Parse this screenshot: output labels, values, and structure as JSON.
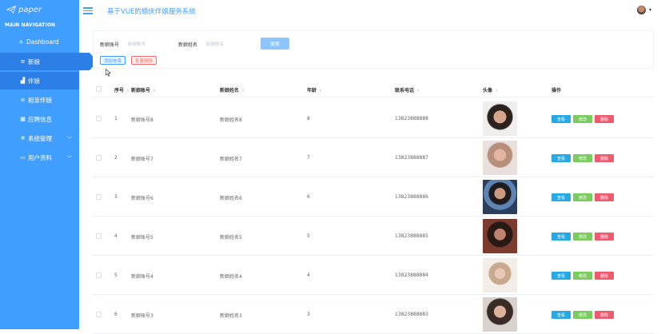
{
  "brand": {
    "logo_text": "paper"
  },
  "sidebar": {
    "section_title": "MAIN NAVIGATION",
    "items": [
      {
        "label": "Dashboard",
        "icon": "home-icon"
      },
      {
        "label": "新娘",
        "icon": "list-icon"
      },
      {
        "label": "伴娘",
        "icon": "chart-icon"
      },
      {
        "label": "相亲伴娘",
        "icon": "list-icon"
      },
      {
        "label": "应聘信息",
        "icon": "grid-icon"
      },
      {
        "label": "系统管理",
        "icon": "gear-icon"
      },
      {
        "label": "用户资料",
        "icon": "card-icon"
      }
    ]
  },
  "header": {
    "title": "基于VUE的婚庆伴娘服务系统"
  },
  "search": {
    "field1_label": "新娘账号",
    "field1_placeholder": "新娘账号",
    "field2_label": "新娘姓名",
    "field2_placeholder": "新娘姓名",
    "search_button": "搜索",
    "add_button": "添加信息",
    "bulk_delete_button": "批量删除"
  },
  "table": {
    "columns": [
      "序号",
      "新娘账号",
      "新娘姓名",
      "年龄",
      "联系电话",
      "头像",
      "操作"
    ],
    "actions": {
      "view": "查看",
      "edit": "修改",
      "delete": "删除"
    },
    "rows": [
      {
        "index": "1",
        "account": "新娘账号8",
        "name": "新娘姓名8",
        "age": "8",
        "phone": "13823888888"
      },
      {
        "index": "2",
        "account": "新娘账号7",
        "name": "新娘姓名7",
        "age": "7",
        "phone": "13823888887"
      },
      {
        "index": "3",
        "account": "新娘账号6",
        "name": "新娘姓名6",
        "age": "6",
        "phone": "13823888886"
      },
      {
        "index": "4",
        "account": "新娘账号5",
        "name": "新娘姓名5",
        "age": "5",
        "phone": "13823888885"
      },
      {
        "index": "5",
        "account": "新娘账号4",
        "name": "新娘姓名4",
        "age": "4",
        "phone": "13823888884"
      },
      {
        "index": "6",
        "account": "新娘账号3",
        "name": "新娘姓名3",
        "age": "3",
        "phone": "13823888883"
      }
    ]
  },
  "colors": {
    "primary": "#409eff",
    "sidebar_active": "#2d7fe8",
    "view": "#27a9e3",
    "edit": "#7bcc5f",
    "delete": "#ee5a6f"
  }
}
